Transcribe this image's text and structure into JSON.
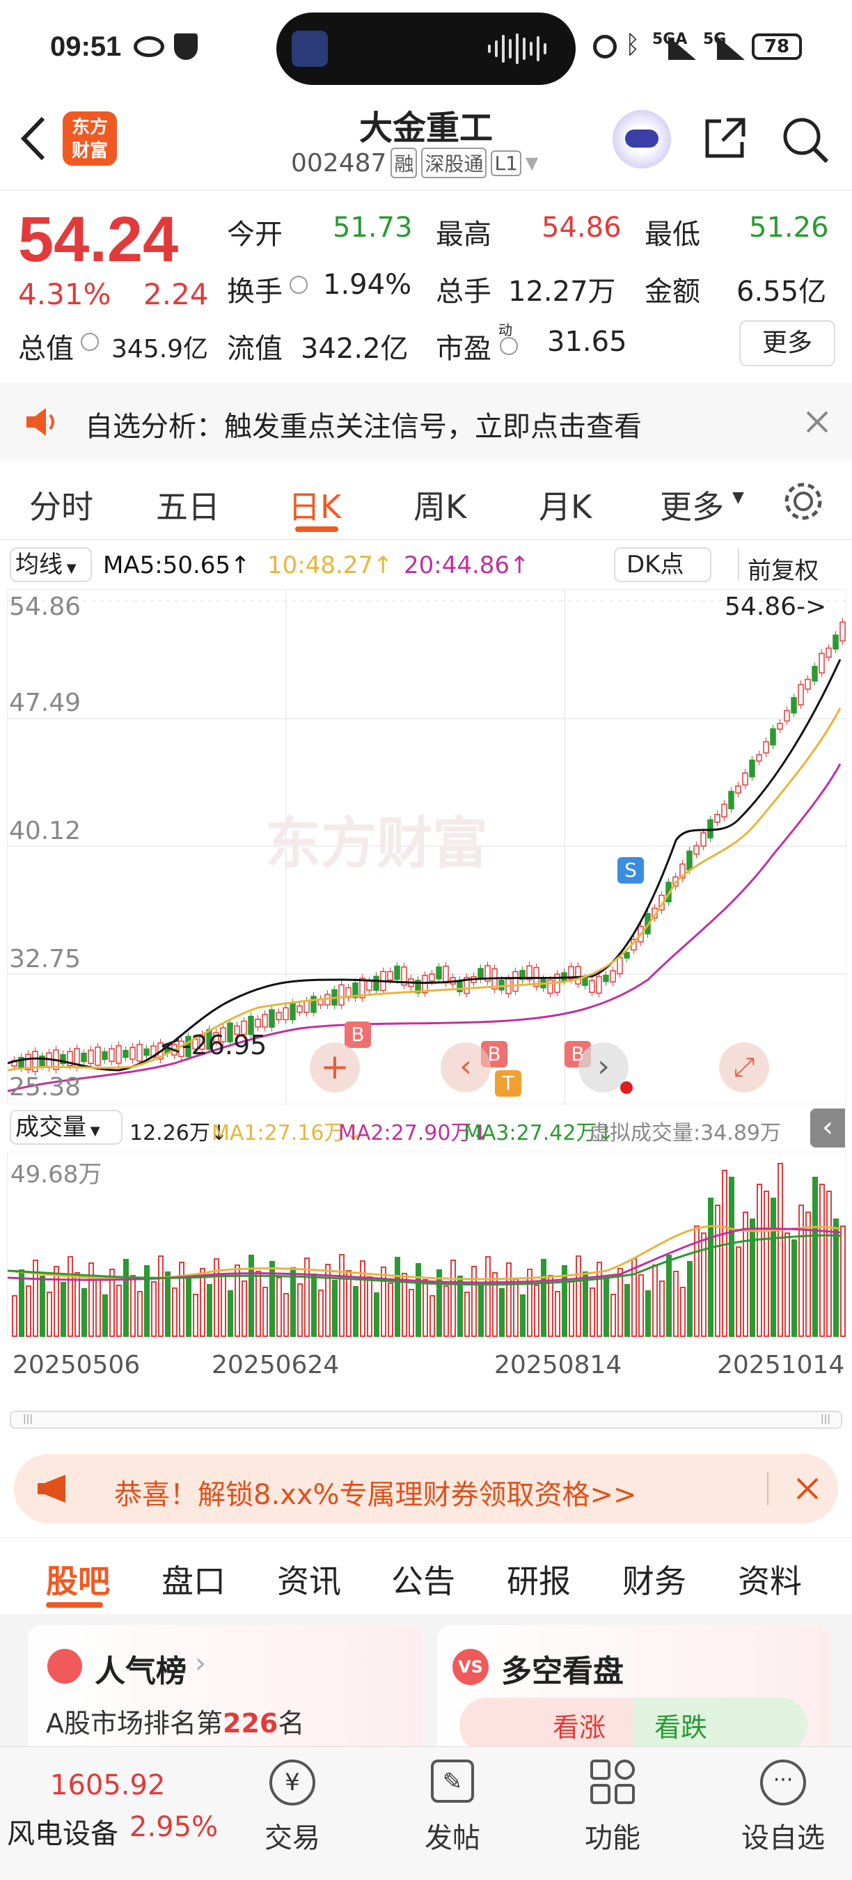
{
  "status": {
    "time": "09:51",
    "battery": "78",
    "signal1": "5GA",
    "signal2": "5G"
  },
  "header": {
    "stock_name": "大金重工",
    "stock_code": "002487",
    "badges": [
      "融",
      "深股通",
      "L1"
    ],
    "logo_line1": "东方",
    "logo_line2": "财富"
  },
  "quote": {
    "price": "54.24",
    "pct": "4.31%",
    "chg": "2.24",
    "open_label": "今开",
    "open": "51.73",
    "high_label": "最高",
    "high": "54.86",
    "low_label": "最低",
    "low": "51.26",
    "turnover_label": "换手",
    "turnover": "1.94%",
    "volume_label": "总手",
    "volume": "12.27万",
    "amount_label": "金额",
    "amount": "6.55亿",
    "mktcap_label": "总值",
    "mktcap": "345.9亿",
    "float_label": "流值",
    "float": "342.2亿",
    "pe_label": "市盈",
    "pe_sup": "动",
    "pe": "31.65",
    "more": "更多"
  },
  "notice": {
    "text": "自选分析：触发重点关注信号，立即点击查看"
  },
  "tabs": [
    "分时",
    "五日",
    "日K",
    "周K",
    "月K",
    "更多"
  ],
  "ma": {
    "selector": "均线",
    "ma5": "MA5:50.65",
    "ma10": "10:48.27",
    "ma20": "20:44.86",
    "dk": "DK点",
    "adjust": "前复权"
  },
  "kline": {
    "y_labels": [
      "54.86",
      "47.49",
      "40.12",
      "32.75",
      "25.38"
    ],
    "high_marker": "54.86->",
    "low_marker": "<-26.95",
    "signals": [
      "S",
      "B",
      "B",
      "T",
      "B"
    ],
    "watermark": "东方财富"
  },
  "vol": {
    "selector": "成交量",
    "vol": "12.26万",
    "ma1": "MA1:27.16万",
    "ma2": "MA2:27.90万",
    "ma3": "MA3:27.42万",
    "virtual": "虚拟成交量:34.89万",
    "max": "49.68万"
  },
  "dates": [
    "20250506",
    "20250624",
    "20250814",
    "20251014"
  ],
  "promo": {
    "text": "恭喜！解锁8.xx%专属理财券领取资格>>"
  },
  "subtabs": [
    "股吧",
    "盘口",
    "资讯",
    "公告",
    "研报",
    "财务",
    "资料"
  ],
  "cards": {
    "popular_title": "人气榜",
    "popular_text_pre": "A股市场排名第",
    "popular_rank": "226",
    "popular_text_post": "名",
    "vs_title": "多空看盘",
    "bull": "看涨",
    "bear": "看跌"
  },
  "bottom": {
    "index_value": "1605.92",
    "sector": "风电设备",
    "sector_pct": "2.95%",
    "buttons": [
      "交易",
      "发帖",
      "功能",
      "设自选"
    ]
  },
  "colors": {
    "up": "#e23a3a",
    "down": "#2a9a32",
    "accent": "#f05a22",
    "ma5": "#111111",
    "ma10": "#e8b53a",
    "ma20": "#c030a0"
  }
}
